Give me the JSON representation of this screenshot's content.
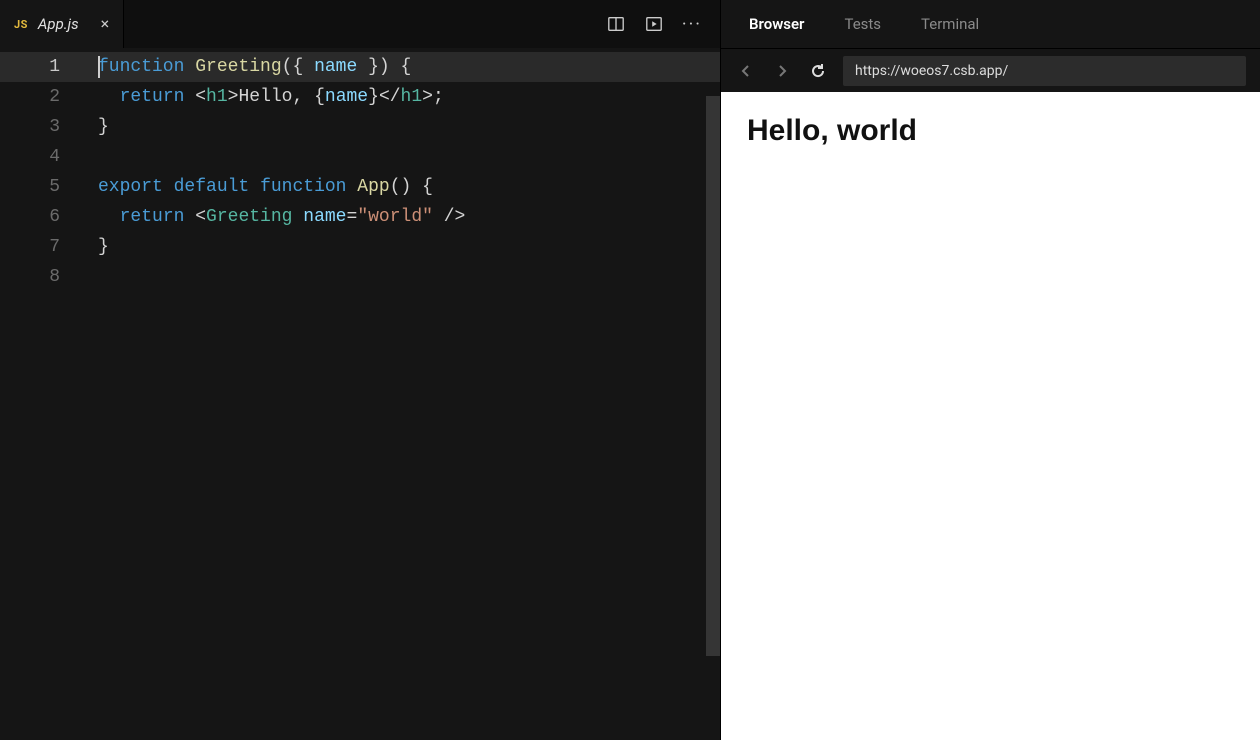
{
  "editor": {
    "tab": {
      "icon_label": "JS",
      "filename": "App.js"
    },
    "line_numbers": [
      "1",
      "2",
      "3",
      "4",
      "5",
      "6",
      "7",
      "8"
    ],
    "highlighted_line": 1,
    "code_tokens": [
      [
        {
          "c": "kw",
          "t": "function"
        },
        {
          "c": "txt",
          "t": " "
        },
        {
          "c": "fn",
          "t": "Greeting"
        },
        {
          "c": "pun",
          "t": "({ "
        },
        {
          "c": "var",
          "t": "name"
        },
        {
          "c": "pun",
          "t": " }) {"
        }
      ],
      [
        {
          "c": "txt",
          "t": "  "
        },
        {
          "c": "kw",
          "t": "return"
        },
        {
          "c": "txt",
          "t": " "
        },
        {
          "c": "pun",
          "t": "<"
        },
        {
          "c": "comp",
          "t": "h1"
        },
        {
          "c": "pun",
          "t": ">"
        },
        {
          "c": "txt",
          "t": "Hello, "
        },
        {
          "c": "pun",
          "t": "{"
        },
        {
          "c": "var",
          "t": "name"
        },
        {
          "c": "pun",
          "t": "}"
        },
        {
          "c": "pun",
          "t": "</"
        },
        {
          "c": "comp",
          "t": "h1"
        },
        {
          "c": "pun",
          "t": ">;"
        }
      ],
      [
        {
          "c": "pun",
          "t": "}"
        }
      ],
      [],
      [
        {
          "c": "kw",
          "t": "export"
        },
        {
          "c": "txt",
          "t": " "
        },
        {
          "c": "kw",
          "t": "default"
        },
        {
          "c": "txt",
          "t": " "
        },
        {
          "c": "kw",
          "t": "function"
        },
        {
          "c": "txt",
          "t": " "
        },
        {
          "c": "fn",
          "t": "App"
        },
        {
          "c": "pun",
          "t": "() {"
        }
      ],
      [
        {
          "c": "txt",
          "t": "  "
        },
        {
          "c": "kw",
          "t": "return"
        },
        {
          "c": "txt",
          "t": " "
        },
        {
          "c": "pun",
          "t": "<"
        },
        {
          "c": "comp",
          "t": "Greeting"
        },
        {
          "c": "txt",
          "t": " "
        },
        {
          "c": "attr",
          "t": "name"
        },
        {
          "c": "pun",
          "t": "="
        },
        {
          "c": "str",
          "t": "\"world\""
        },
        {
          "c": "txt",
          "t": " "
        },
        {
          "c": "pun",
          "t": "/>"
        }
      ],
      [
        {
          "c": "pun",
          "t": "}"
        }
      ],
      []
    ]
  },
  "right": {
    "tabs": [
      {
        "label": "Browser",
        "active": true
      },
      {
        "label": "Tests",
        "active": false
      },
      {
        "label": "Terminal",
        "active": false
      }
    ],
    "url": "https://woeos7.csb.app/",
    "output_heading": "Hello, world"
  }
}
